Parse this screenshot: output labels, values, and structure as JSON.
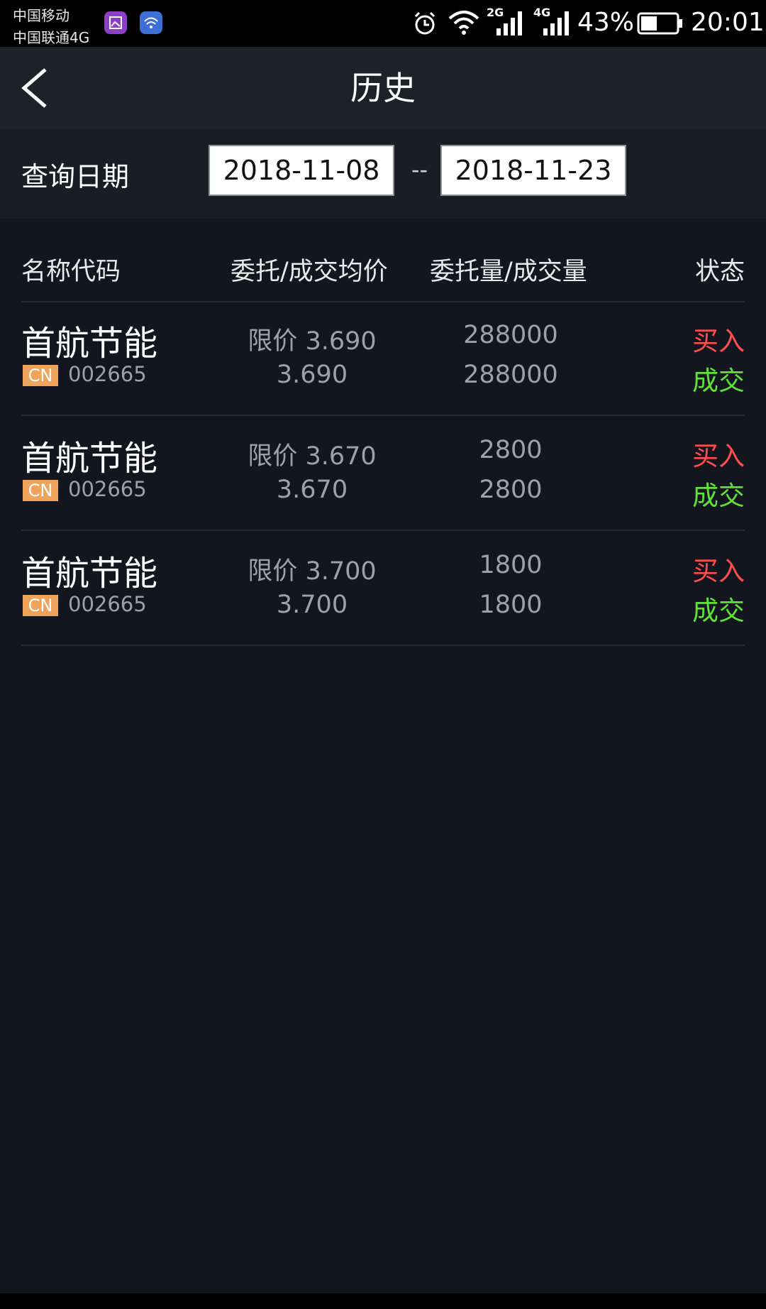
{
  "status_bar": {
    "carrier_1": "中国移动",
    "carrier_2": "中国联通4G",
    "net_1": "2G",
    "net_2": "4G",
    "battery": "43%",
    "time": "20:01",
    "icons": [
      "gallery-icon",
      "wifi-app-icon",
      "alarm-icon",
      "wifi-icon",
      "signal-icon",
      "battery-icon"
    ]
  },
  "nav": {
    "title": "历史",
    "back_icon": "chevron-left-icon"
  },
  "query": {
    "label": "查询日期",
    "start_date": "2018-11-08",
    "separator": "--",
    "end_date": "2018-11-23"
  },
  "table": {
    "headers": {
      "name_code": "名称代码",
      "price": "委托/成交均价",
      "quantity": "委托量/成交量",
      "status": "状态"
    },
    "rows": [
      {
        "name": "首航节能",
        "market": "CN",
        "code": "002665",
        "order_price": "限价 3.690",
        "avg_price": "3.690",
        "order_qty": "288000",
        "filled_qty": "288000",
        "side": "买入",
        "status": "成交"
      },
      {
        "name": "首航节能",
        "market": "CN",
        "code": "002665",
        "order_price": "限价 3.670",
        "avg_price": "3.670",
        "order_qty": "2800",
        "filled_qty": "2800",
        "side": "买入",
        "status": "成交"
      },
      {
        "name": "首航节能",
        "market": "CN",
        "code": "002665",
        "order_price": "限价 3.700",
        "avg_price": "3.700",
        "order_qty": "1800",
        "filled_qty": "1800",
        "side": "买入",
        "status": "成交"
      }
    ]
  },
  "colors": {
    "background": "#13161e",
    "buy": "#ff4d4d",
    "filled": "#5fe13a",
    "market_badge": "#f0a35a"
  }
}
